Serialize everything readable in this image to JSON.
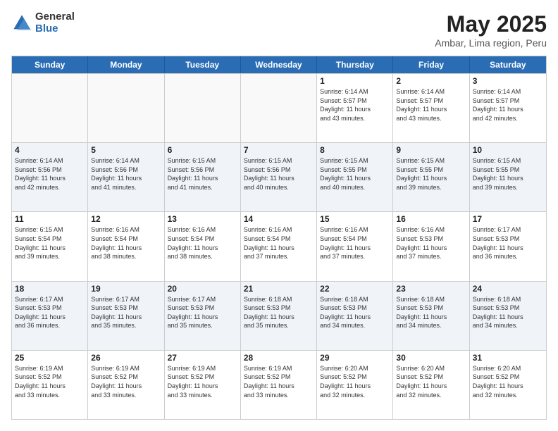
{
  "logo": {
    "general": "General",
    "blue": "Blue"
  },
  "header": {
    "title": "May 2025",
    "subtitle": "Ambar, Lima region, Peru"
  },
  "dayHeaders": [
    "Sunday",
    "Monday",
    "Tuesday",
    "Wednesday",
    "Thursday",
    "Friday",
    "Saturday"
  ],
  "rows": [
    {
      "alt": false,
      "cells": [
        {
          "empty": true,
          "day": "",
          "info": ""
        },
        {
          "empty": true,
          "day": "",
          "info": ""
        },
        {
          "empty": true,
          "day": "",
          "info": ""
        },
        {
          "empty": true,
          "day": "",
          "info": ""
        },
        {
          "empty": false,
          "day": "1",
          "info": "Sunrise: 6:14 AM\nSunset: 5:57 PM\nDaylight: 11 hours\nand 43 minutes."
        },
        {
          "empty": false,
          "day": "2",
          "info": "Sunrise: 6:14 AM\nSunset: 5:57 PM\nDaylight: 11 hours\nand 43 minutes."
        },
        {
          "empty": false,
          "day": "3",
          "info": "Sunrise: 6:14 AM\nSunset: 5:57 PM\nDaylight: 11 hours\nand 42 minutes."
        }
      ]
    },
    {
      "alt": true,
      "cells": [
        {
          "empty": false,
          "day": "4",
          "info": "Sunrise: 6:14 AM\nSunset: 5:56 PM\nDaylight: 11 hours\nand 42 minutes."
        },
        {
          "empty": false,
          "day": "5",
          "info": "Sunrise: 6:14 AM\nSunset: 5:56 PM\nDaylight: 11 hours\nand 41 minutes."
        },
        {
          "empty": false,
          "day": "6",
          "info": "Sunrise: 6:15 AM\nSunset: 5:56 PM\nDaylight: 11 hours\nand 41 minutes."
        },
        {
          "empty": false,
          "day": "7",
          "info": "Sunrise: 6:15 AM\nSunset: 5:56 PM\nDaylight: 11 hours\nand 40 minutes."
        },
        {
          "empty": false,
          "day": "8",
          "info": "Sunrise: 6:15 AM\nSunset: 5:55 PM\nDaylight: 11 hours\nand 40 minutes."
        },
        {
          "empty": false,
          "day": "9",
          "info": "Sunrise: 6:15 AM\nSunset: 5:55 PM\nDaylight: 11 hours\nand 39 minutes."
        },
        {
          "empty": false,
          "day": "10",
          "info": "Sunrise: 6:15 AM\nSunset: 5:55 PM\nDaylight: 11 hours\nand 39 minutes."
        }
      ]
    },
    {
      "alt": false,
      "cells": [
        {
          "empty": false,
          "day": "11",
          "info": "Sunrise: 6:15 AM\nSunset: 5:54 PM\nDaylight: 11 hours\nand 39 minutes."
        },
        {
          "empty": false,
          "day": "12",
          "info": "Sunrise: 6:16 AM\nSunset: 5:54 PM\nDaylight: 11 hours\nand 38 minutes."
        },
        {
          "empty": false,
          "day": "13",
          "info": "Sunrise: 6:16 AM\nSunset: 5:54 PM\nDaylight: 11 hours\nand 38 minutes."
        },
        {
          "empty": false,
          "day": "14",
          "info": "Sunrise: 6:16 AM\nSunset: 5:54 PM\nDaylight: 11 hours\nand 37 minutes."
        },
        {
          "empty": false,
          "day": "15",
          "info": "Sunrise: 6:16 AM\nSunset: 5:54 PM\nDaylight: 11 hours\nand 37 minutes."
        },
        {
          "empty": false,
          "day": "16",
          "info": "Sunrise: 6:16 AM\nSunset: 5:53 PM\nDaylight: 11 hours\nand 37 minutes."
        },
        {
          "empty": false,
          "day": "17",
          "info": "Sunrise: 6:17 AM\nSunset: 5:53 PM\nDaylight: 11 hours\nand 36 minutes."
        }
      ]
    },
    {
      "alt": true,
      "cells": [
        {
          "empty": false,
          "day": "18",
          "info": "Sunrise: 6:17 AM\nSunset: 5:53 PM\nDaylight: 11 hours\nand 36 minutes."
        },
        {
          "empty": false,
          "day": "19",
          "info": "Sunrise: 6:17 AM\nSunset: 5:53 PM\nDaylight: 11 hours\nand 35 minutes."
        },
        {
          "empty": false,
          "day": "20",
          "info": "Sunrise: 6:17 AM\nSunset: 5:53 PM\nDaylight: 11 hours\nand 35 minutes."
        },
        {
          "empty": false,
          "day": "21",
          "info": "Sunrise: 6:18 AM\nSunset: 5:53 PM\nDaylight: 11 hours\nand 35 minutes."
        },
        {
          "empty": false,
          "day": "22",
          "info": "Sunrise: 6:18 AM\nSunset: 5:53 PM\nDaylight: 11 hours\nand 34 minutes."
        },
        {
          "empty": false,
          "day": "23",
          "info": "Sunrise: 6:18 AM\nSunset: 5:53 PM\nDaylight: 11 hours\nand 34 minutes."
        },
        {
          "empty": false,
          "day": "24",
          "info": "Sunrise: 6:18 AM\nSunset: 5:53 PM\nDaylight: 11 hours\nand 34 minutes."
        }
      ]
    },
    {
      "alt": false,
      "cells": [
        {
          "empty": false,
          "day": "25",
          "info": "Sunrise: 6:19 AM\nSunset: 5:52 PM\nDaylight: 11 hours\nand 33 minutes."
        },
        {
          "empty": false,
          "day": "26",
          "info": "Sunrise: 6:19 AM\nSunset: 5:52 PM\nDaylight: 11 hours\nand 33 minutes."
        },
        {
          "empty": false,
          "day": "27",
          "info": "Sunrise: 6:19 AM\nSunset: 5:52 PM\nDaylight: 11 hours\nand 33 minutes."
        },
        {
          "empty": false,
          "day": "28",
          "info": "Sunrise: 6:19 AM\nSunset: 5:52 PM\nDaylight: 11 hours\nand 33 minutes."
        },
        {
          "empty": false,
          "day": "29",
          "info": "Sunrise: 6:20 AM\nSunset: 5:52 PM\nDaylight: 11 hours\nand 32 minutes."
        },
        {
          "empty": false,
          "day": "30",
          "info": "Sunrise: 6:20 AM\nSunset: 5:52 PM\nDaylight: 11 hours\nand 32 minutes."
        },
        {
          "empty": false,
          "day": "31",
          "info": "Sunrise: 6:20 AM\nSunset: 5:52 PM\nDaylight: 11 hours\nand 32 minutes."
        }
      ]
    }
  ]
}
